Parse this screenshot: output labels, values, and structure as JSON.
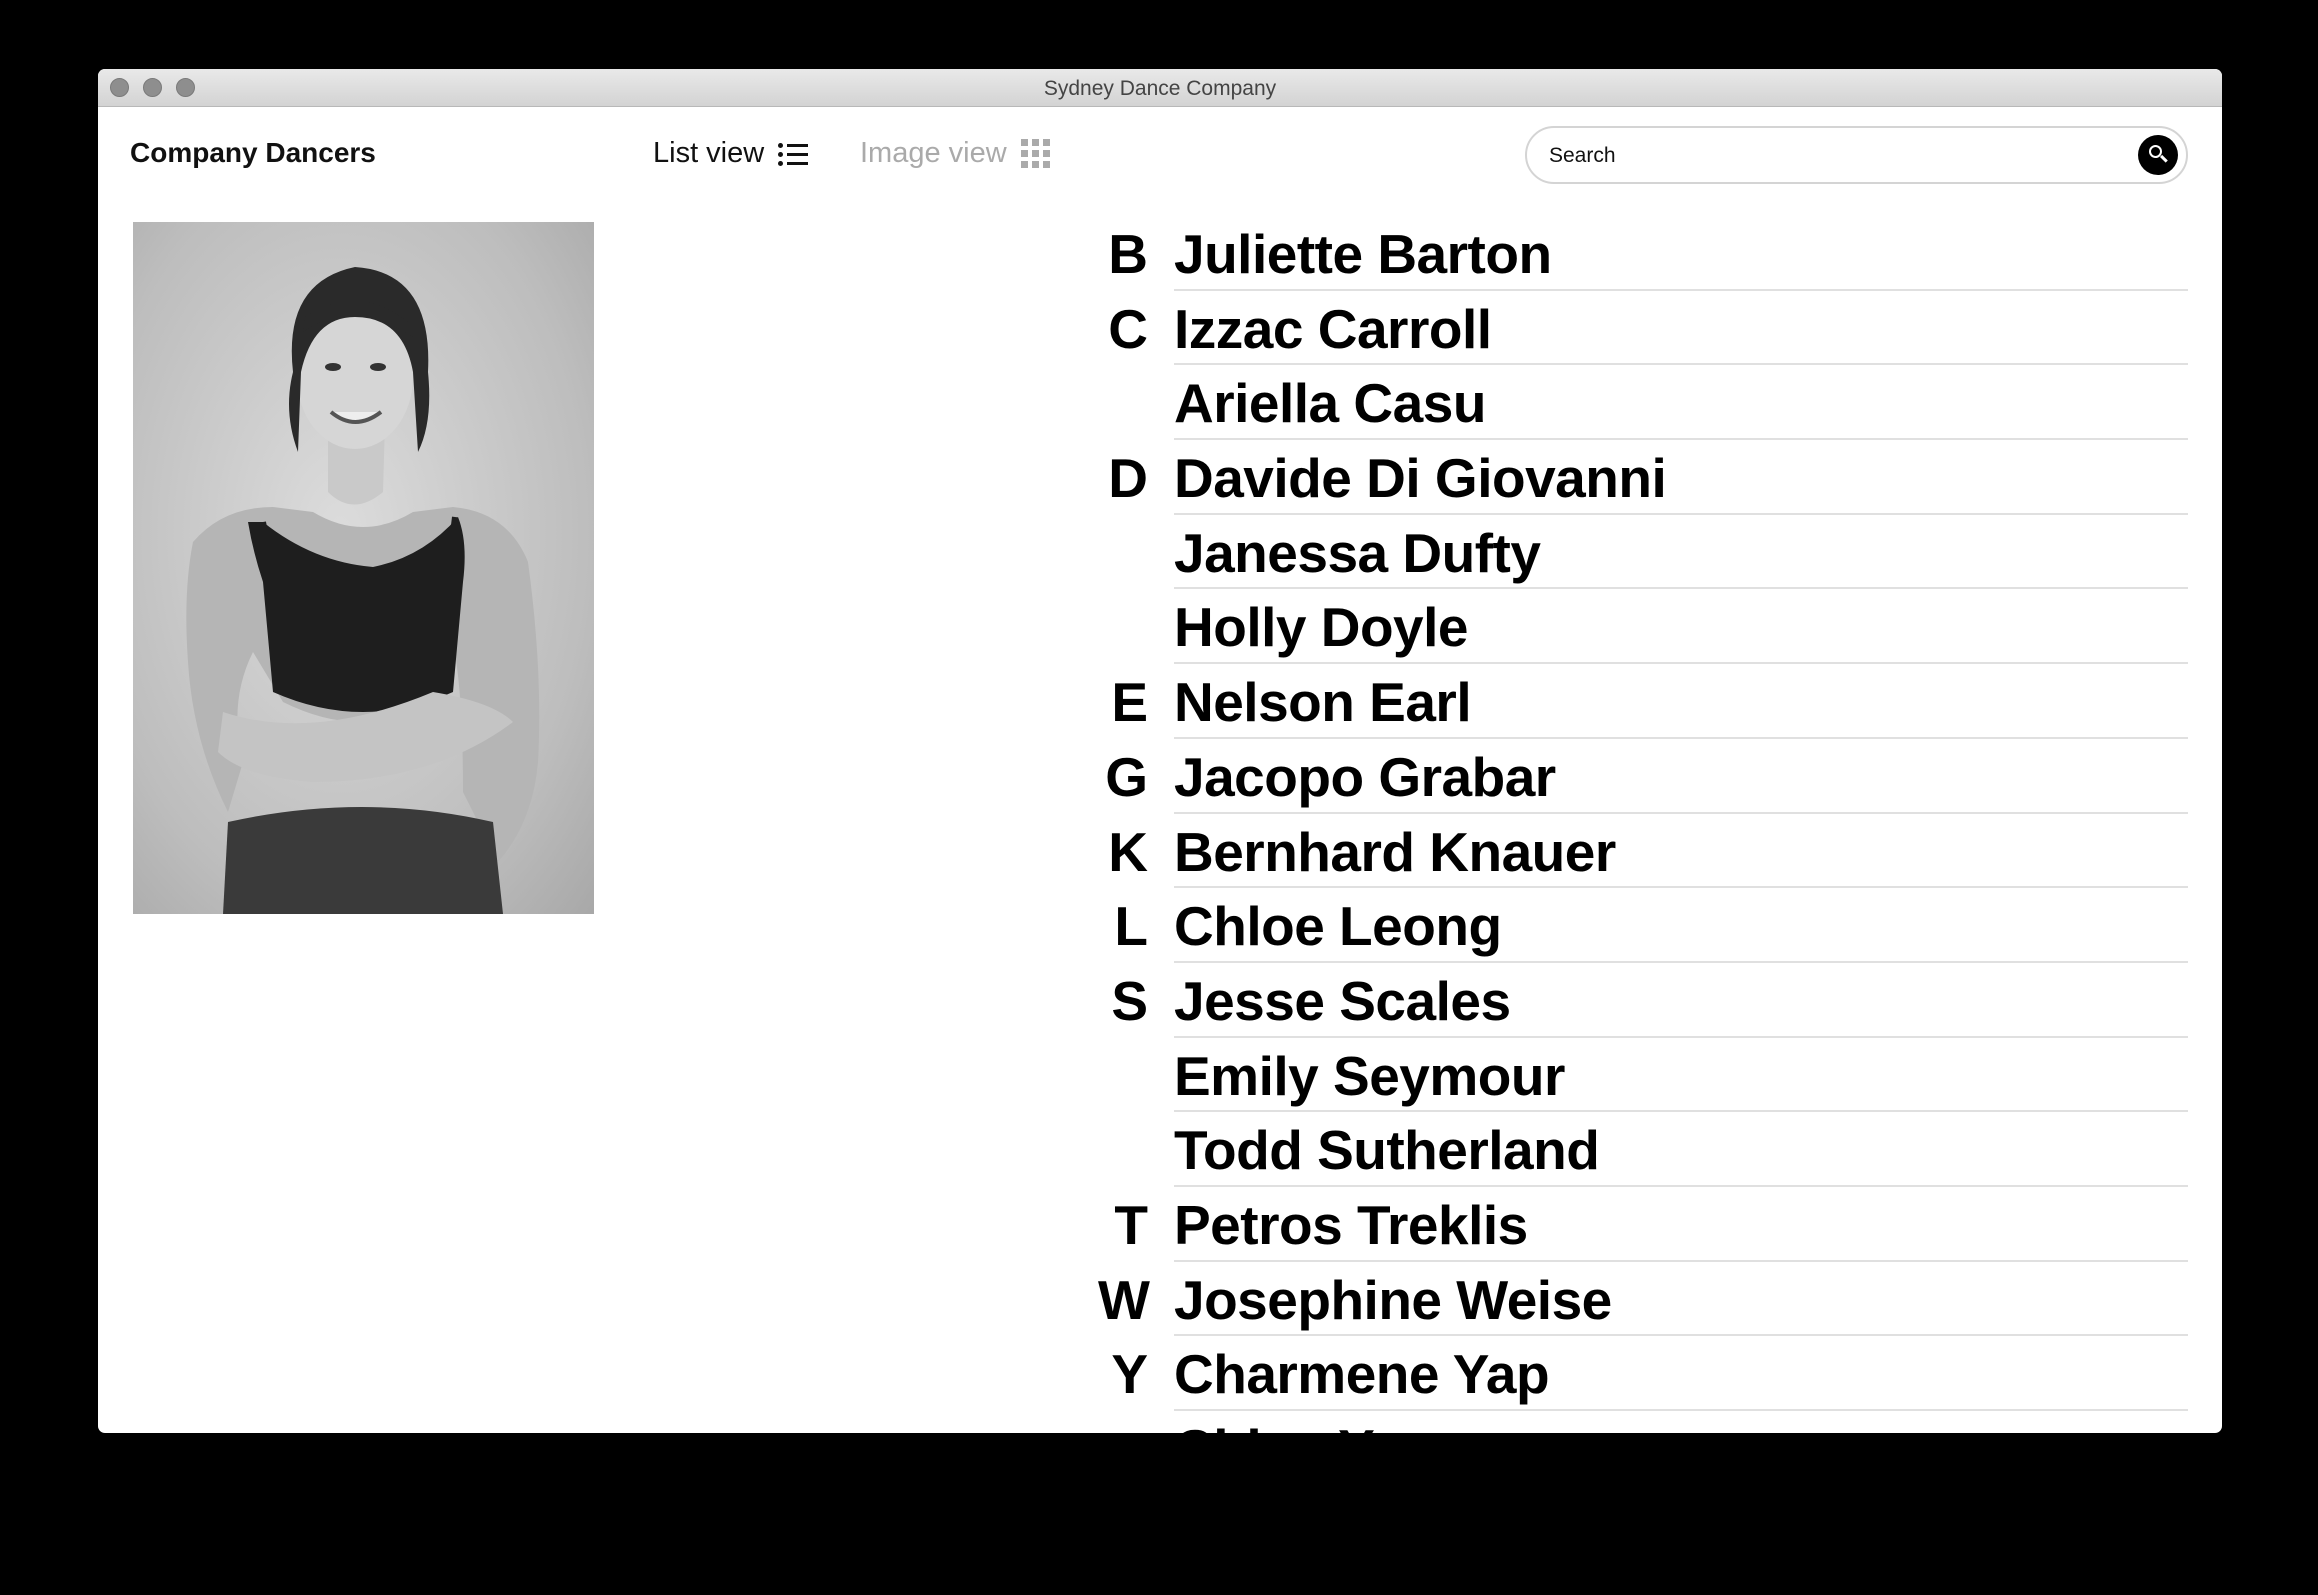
{
  "window": {
    "title": "Sydney Dance Company"
  },
  "header": {
    "title": "Company Dancers",
    "list_view_label": "List view",
    "image_view_label": "Image view"
  },
  "search": {
    "placeholder": "Search",
    "value": ""
  },
  "portrait": {
    "icon": "dancer-portrait-photo"
  },
  "dancers": [
    {
      "letter": "B",
      "name": "Juliette Barton"
    },
    {
      "letter": "C",
      "name": "Izzac Carroll"
    },
    {
      "letter": "",
      "name": "Ariella Casu"
    },
    {
      "letter": "D",
      "name": "Davide Di Giovanni"
    },
    {
      "letter": "",
      "name": "Janessa Dufty"
    },
    {
      "letter": "",
      "name": "Holly Doyle"
    },
    {
      "letter": "E",
      "name": "Nelson Earl"
    },
    {
      "letter": "G",
      "name": "Jacopo Grabar"
    },
    {
      "letter": "K",
      "name": "Bernhard Knauer"
    },
    {
      "letter": "L",
      "name": "Chloe Leong"
    },
    {
      "letter": "S",
      "name": "Jesse Scales"
    },
    {
      "letter": "",
      "name": "Emily Seymour"
    },
    {
      "letter": "",
      "name": "Todd Sutherland"
    },
    {
      "letter": "T",
      "name": "Petros Treklis"
    },
    {
      "letter": "W",
      "name": "Josephine Weise"
    },
    {
      "letter": "Y",
      "name": "Charmene Yap"
    },
    {
      "letter": "",
      "name": "Chloe Young"
    }
  ]
}
